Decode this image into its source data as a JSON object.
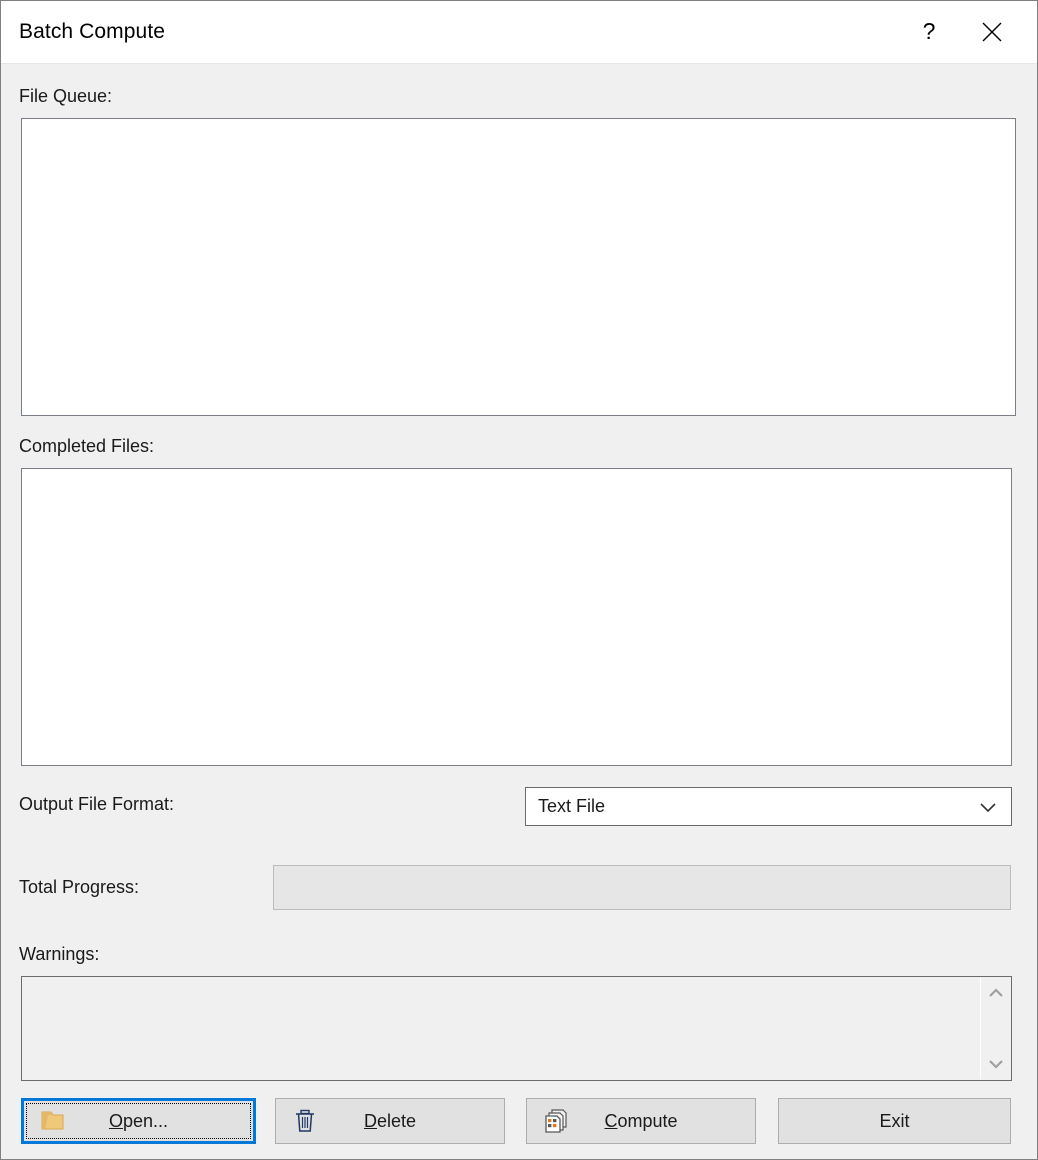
{
  "window": {
    "title": "Batch Compute",
    "help_icon": "question-mark-icon",
    "close_icon": "close-icon",
    "background_color": "#f0f0f0",
    "titlebar_color": "#ffffff"
  },
  "file_queue": {
    "label": "File Queue:",
    "items": []
  },
  "completed_files": {
    "label": "Completed Files:",
    "items": []
  },
  "output_format": {
    "label": "Output File Format:",
    "selected": "Text File",
    "options": [
      "Text File"
    ],
    "chevron_icon": "chevron-down-icon"
  },
  "total_progress": {
    "label": "Total Progress:",
    "value": 0,
    "value_text": "",
    "fill_color": "#06b025",
    "track_color": "#e6e6e6"
  },
  "warnings": {
    "label": "Warnings:",
    "text": "",
    "scroll_up_icon": "chevron-up-icon",
    "scroll_down_icon": "chevron-down-icon"
  },
  "buttons": {
    "open": {
      "label_pre": "",
      "accel": "O",
      "label_post": "pen...",
      "icon": "folder-icon",
      "focused": true,
      "focus_color": "#0078d7"
    },
    "delete": {
      "label_pre": "",
      "accel": "D",
      "label_post": "elete",
      "icon": "trash-icon",
      "focused": false
    },
    "compute": {
      "label_pre": "",
      "accel": "C",
      "label_post": "ompute",
      "icon": "documents-stack-icon",
      "focused": false
    },
    "exit": {
      "label": "Exit",
      "icon": "",
      "focused": false
    }
  }
}
